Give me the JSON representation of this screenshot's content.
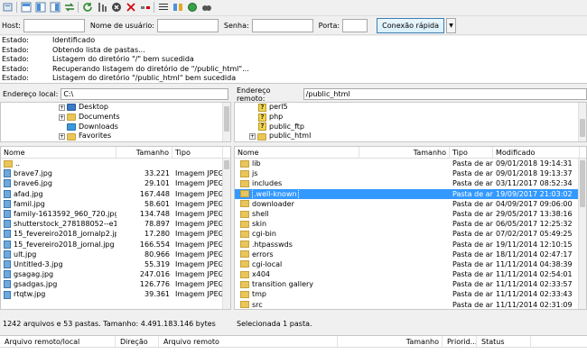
{
  "toolbar": {
    "icons": [
      "site-manager-icon",
      "toggle-log-icon",
      "toggle-local-tree-icon",
      "toggle-remote-tree-icon",
      "transfer-queue-icon",
      "refresh-icon",
      "process-queue-icon",
      "cancel-icon",
      "disconnect-icon",
      "reconnect-icon",
      "filter-icon",
      "compare-icon",
      "sync-browse-icon",
      "search-icon"
    ]
  },
  "quickconnect": {
    "host_label": "Host:",
    "user_label": "Nome de usuário:",
    "pass_label": "Senha:",
    "port_label": "Porta:",
    "button_label": "Conexão rápida",
    "host_value": "",
    "user_value": "",
    "pass_value": "",
    "port_value": ""
  },
  "log": [
    {
      "k": "Estado:",
      "v": "Identificado"
    },
    {
      "k": "Estado:",
      "v": "Obtendo lista de pastas..."
    },
    {
      "k": "Estado:",
      "v": "Listagem do diretório \"/\" bem sucedida"
    },
    {
      "k": "Estado:",
      "v": "Recuperando listagem do diretório de \"/public_html\"..."
    },
    {
      "k": "Estado:",
      "v": "Listagem do diretório \"/public_html\" bem sucedida"
    }
  ],
  "local": {
    "address_label": "Endereço local:",
    "address_value": "C:\\",
    "tree": [
      "Desktop",
      "Documents",
      "Downloads",
      "Favorites"
    ],
    "cols": [
      "Nome",
      "Tamanho",
      "Tipo"
    ],
    "files": [
      {
        "n": "..",
        "s": "",
        "t": "",
        "dir": true
      },
      {
        "n": "brave7.jpg",
        "s": "33.221",
        "t": "Imagem JPEG"
      },
      {
        "n": "brave6.jpg",
        "s": "29.101",
        "t": "Imagem JPEG"
      },
      {
        "n": "afad.jpg",
        "s": "167.448",
        "t": "Imagem JPEG"
      },
      {
        "n": "famil.jpg",
        "s": "58.601",
        "t": "Imagem JPEG"
      },
      {
        "n": "family-1613592_960_720.jpg",
        "s": "134.748",
        "t": "Imagem JPEG"
      },
      {
        "n": "shutterstock_278188052--e147610146...",
        "s": "78.897",
        "t": "Imagem JPEG"
      },
      {
        "n": "15_fevereiro2018_jornalp2.jpg",
        "s": "17.280",
        "t": "Imagem JPEG"
      },
      {
        "n": "15_fevereiro2018_jornal.jpg",
        "s": "166.554",
        "t": "Imagem JPEG"
      },
      {
        "n": "ult.jpg",
        "s": "80.966",
        "t": "Imagem JPEG"
      },
      {
        "n": "Untitled-3.jpg",
        "s": "55.319",
        "t": "Imagem JPEG"
      },
      {
        "n": "gsagag.jpg",
        "s": "247.016",
        "t": "Imagem JPEG"
      },
      {
        "n": "gsadgas.jpg",
        "s": "126.776",
        "t": "Imagem JPEG"
      },
      {
        "n": "rtqtw.jpg",
        "s": "39.361",
        "t": "Imagem JPEG"
      }
    ],
    "status": "1242 arquivos e 53 pastas. Tamanho: 4.491.183.146 bytes"
  },
  "remote": {
    "address_label": "Endereço remoto:",
    "address_value": "/public_html",
    "tree": [
      {
        "n": "perl5",
        "q": true
      },
      {
        "n": "php",
        "q": true
      },
      {
        "n": "public_ftp",
        "q": true
      },
      {
        "n": "public_html",
        "q": false
      }
    ],
    "cols": [
      "Nome",
      "Tamanho",
      "Tipo",
      "Modificado"
    ],
    "files": [
      {
        "n": "lib",
        "t": "Pasta de ar...",
        "m": "09/01/2018 19:14:31"
      },
      {
        "n": "js",
        "t": "Pasta de ar...",
        "m": "09/01/2018 19:13:37"
      },
      {
        "n": "includes",
        "t": "Pasta de ar...",
        "m": "03/11/2017 08:52:34"
      },
      {
        "n": ".well-known",
        "t": "Pasta de ar...",
        "m": "19/09/2017 21:03:02",
        "sel": true
      },
      {
        "n": "downloader",
        "t": "Pasta de ar...",
        "m": "04/09/2017 09:06:00"
      },
      {
        "n": "shell",
        "t": "Pasta de ar...",
        "m": "29/05/2017 13:38:16"
      },
      {
        "n": "skin",
        "t": "Pasta de ar...",
        "m": "06/05/2017 12:25:32"
      },
      {
        "n": "cgi-bin",
        "t": "Pasta de ar...",
        "m": "07/02/2017 05:49:25"
      },
      {
        "n": ".htpasswds",
        "t": "Pasta de ar...",
        "m": "19/11/2014 12:10:15"
      },
      {
        "n": "errors",
        "t": "Pasta de ar...",
        "m": "18/11/2014 02:47:17"
      },
      {
        "n": "cgi-local",
        "t": "Pasta de ar...",
        "m": "11/11/2014 04:38:39"
      },
      {
        "n": "x404",
        "t": "Pasta de ar...",
        "m": "11/11/2014 02:54:01"
      },
      {
        "n": "transition gallery",
        "t": "Pasta de ar...",
        "m": "11/11/2014 02:33:57"
      },
      {
        "n": "tmp",
        "t": "Pasta de ar...",
        "m": "11/11/2014 02:33:43"
      },
      {
        "n": "src",
        "t": "Pasta de ar...",
        "m": "11/11/2014 02:31:09"
      }
    ],
    "status": "Selecionada 1 pasta."
  },
  "queue": {
    "cols": [
      "Arquivo remoto/local",
      "Direção",
      "Arquivo remoto",
      "Tamanho",
      "Priorid...",
      "Status"
    ]
  }
}
